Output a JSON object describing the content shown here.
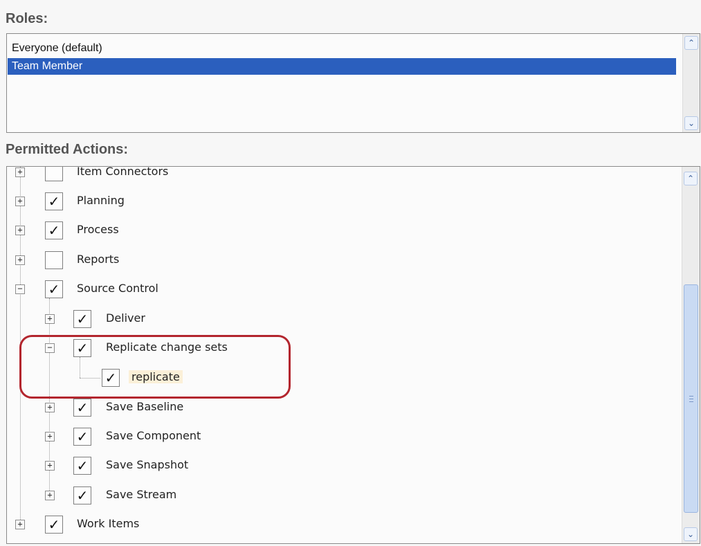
{
  "roles": {
    "label": "Roles:",
    "items": [
      {
        "label": "Everyone (default)",
        "selected": false
      },
      {
        "label": "Team Member",
        "selected": true
      }
    ]
  },
  "permitted": {
    "label": "Permitted Actions:",
    "nodes": [
      {
        "label": "Item Connectors",
        "expander": "+",
        "checked": false
      },
      {
        "label": "Planning",
        "expander": "+",
        "checked": true
      },
      {
        "label": "Process",
        "expander": "+",
        "checked": true
      },
      {
        "label": "Reports",
        "expander": "+",
        "checked": false
      },
      {
        "label": "Source Control",
        "expander": "−",
        "checked": true
      },
      {
        "label": "Deliver",
        "expander": "+",
        "checked": true
      },
      {
        "label": "Replicate change sets",
        "expander": "−",
        "checked": true
      },
      {
        "label": "replicate",
        "expander": "",
        "checked": true
      },
      {
        "label": "Save Baseline",
        "expander": "+",
        "checked": true
      },
      {
        "label": "Save Component",
        "expander": "+",
        "checked": true
      },
      {
        "label": "Save Snapshot",
        "expander": "+",
        "checked": true
      },
      {
        "label": "Save Stream",
        "expander": "+",
        "checked": true
      },
      {
        "label": "Work Items",
        "expander": "+",
        "checked": true
      }
    ]
  },
  "glyphs": {
    "check": "✓",
    "scroll_up": "⌃",
    "scroll_down": "⌄"
  },
  "colors": {
    "selection": "#2b5fbe",
    "callout": "#b3262e"
  }
}
